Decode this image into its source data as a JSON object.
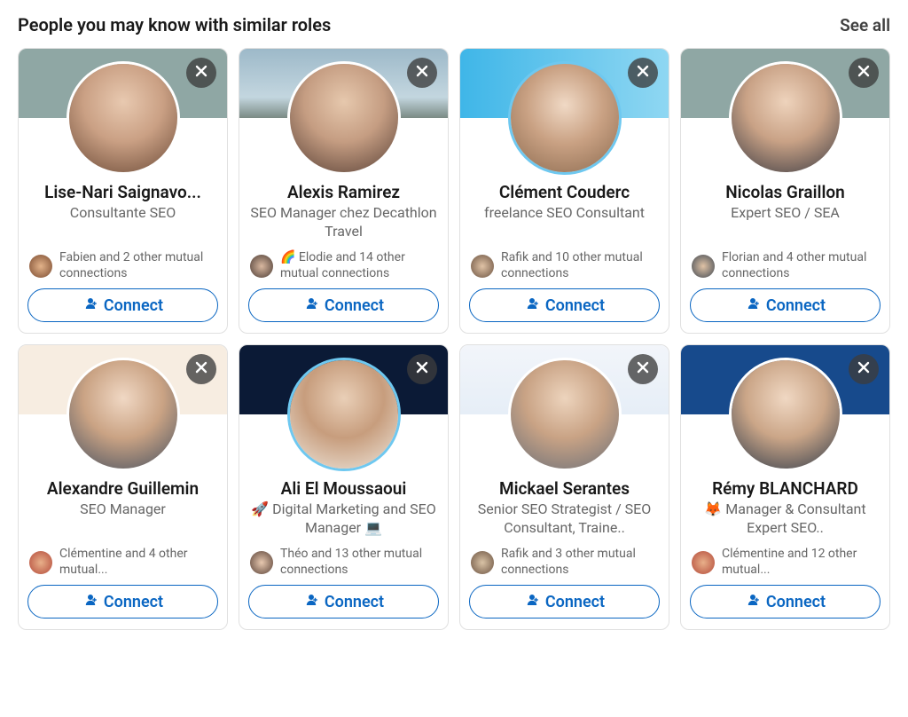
{
  "header": {
    "title": "People you may know with similar roles",
    "see_all": "See all"
  },
  "connect_label": "Connect",
  "people": [
    {
      "name": "Lise-Nari Saignavo...",
      "role": "Consultante SEO",
      "mutual": "Fabien and 2 other mutual connections",
      "cover_class": "cover-1",
      "avatar_class": "av-a",
      "mutual_avatar_class": "mut-a",
      "ring": false
    },
    {
      "name": "Alexis Ramirez",
      "role": "SEO Manager chez Decathlon Travel",
      "mutual": "🌈 Elodie and 14 other mutual connections",
      "cover_class": "cover-2",
      "avatar_class": "av-b",
      "mutual_avatar_class": "mut-b",
      "ring": false
    },
    {
      "name": "Clément Couderc",
      "role": "freelance SEO Consultant",
      "mutual": "Rafik and 10 other mutual connections",
      "cover_class": "cover-3",
      "avatar_class": "av-c",
      "mutual_avatar_class": "mut-c",
      "ring": true
    },
    {
      "name": "Nicolas Graillon",
      "role": "Expert SEO / SEA",
      "mutual": "Florian and 4 other mutual connections",
      "cover_class": "cover-4",
      "avatar_class": "av-d",
      "mutual_avatar_class": "mut-d",
      "ring": false
    },
    {
      "name": "Alexandre Guillemin",
      "role": "SEO Manager",
      "mutual": "Clémentine and 4 other mutual...",
      "cover_class": "cover-5",
      "avatar_class": "av-e",
      "mutual_avatar_class": "mut-e",
      "ring": false
    },
    {
      "name": "Ali El Moussaoui",
      "role": "🚀 Digital Marketing and SEO Manager 💻",
      "mutual": "Théo and 13 other mutual connections",
      "cover_class": "cover-6",
      "avatar_class": "av-f",
      "mutual_avatar_class": "mut-f",
      "ring": true
    },
    {
      "name": "Mickael Serantes",
      "role": "Senior SEO Strategist / SEO Consultant, Traine..",
      "mutual": "Rafik and 3 other mutual connections",
      "cover_class": "cover-7",
      "avatar_class": "av-g",
      "mutual_avatar_class": "mut-g",
      "ring": false
    },
    {
      "name": "Rémy BLANCHARD",
      "role": "🦊 Manager & Consultant Expert SEO..",
      "mutual": "Clémentine and 12 other mutual...",
      "cover_class": "cover-8",
      "avatar_class": "av-h",
      "mutual_avatar_class": "mut-h",
      "ring": false
    }
  ]
}
